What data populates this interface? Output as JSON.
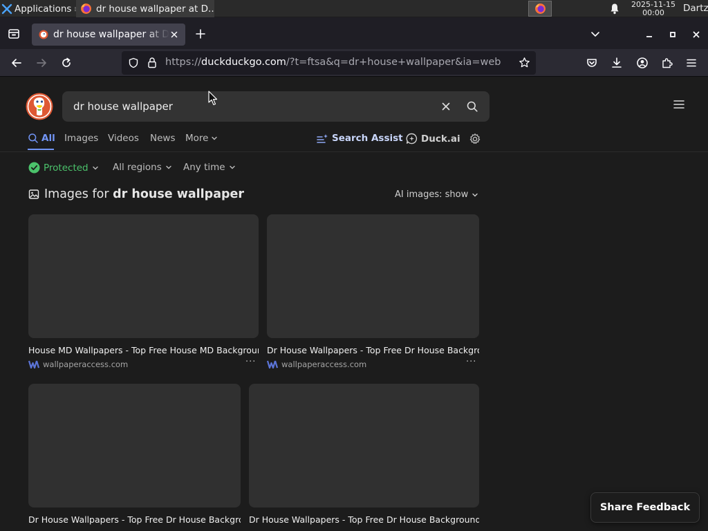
{
  "os": {
    "applications_label": "Applications",
    "task_title": "dr house wallpaper at D...",
    "clock_date": "2025-11-15",
    "clock_time": "00:00",
    "user": "Dartz"
  },
  "browser": {
    "tab_title": "dr house wallpaper at DuckDuckGo",
    "url_prefix": "https://",
    "url_domain": "duckduckgo.com",
    "url_rest": "/?t=ftsa&q=dr+house+wallpaper&ia=web"
  },
  "search": {
    "query": "dr house wallpaper",
    "tabs": [
      "All",
      "Images",
      "Videos",
      "News",
      "More"
    ],
    "search_assist": "Search Assist",
    "duck_ai": "Duck.ai"
  },
  "filters": {
    "protected": "Protected",
    "regions": "All regions",
    "time": "Any time"
  },
  "images_module": {
    "heading_prefix": "Images for ",
    "heading_query": "dr house wallpaper",
    "ai_images": "AI images: show",
    "items": [
      {
        "title": "House MD Wallpapers - Top Free House MD Backgroun...",
        "source": "wallpaperaccess.com"
      },
      {
        "title": "Dr House Wallpapers - Top Free Dr House Backgro...",
        "source": "wallpaperaccess.com"
      },
      {
        "title": "Dr House Wallpapers - Top Free Dr House Backgro...",
        "source": ""
      },
      {
        "title": "Dr House Wallpapers - Top Free Dr House Backgrounds...",
        "source": ""
      }
    ]
  },
  "feedback_label": "Share Feedback",
  "colors": {
    "accent_blue": "#7295f6",
    "protected_green": "#4bc26b",
    "ddg_orange": "#de5833"
  }
}
